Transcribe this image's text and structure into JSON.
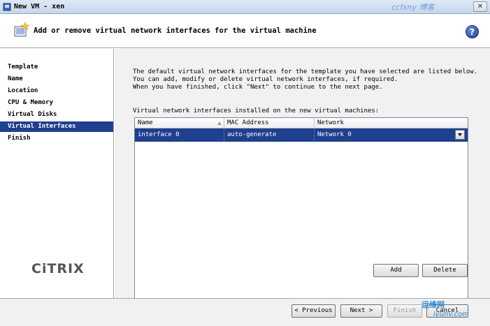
{
  "window": {
    "title": "New VM - xen",
    "close_label": "✕"
  },
  "watermarks": {
    "top": "ccfxny 博客",
    "bottom_cn": "运维网",
    "bottom_url": "iyunv.com"
  },
  "header": {
    "title": "Add or remove virtual network interfaces for the virtual machine",
    "help_label": "?"
  },
  "sidebar": {
    "items": [
      {
        "label": "Template"
      },
      {
        "label": "Name"
      },
      {
        "label": "Location"
      },
      {
        "label": "CPU & Memory"
      },
      {
        "label": "Virtual Disks"
      },
      {
        "label": "Virtual Interfaces"
      },
      {
        "label": "Finish"
      }
    ],
    "active_index": 5,
    "logo_text": "CiTRIX"
  },
  "main": {
    "intro_lines": [
      "The default virtual network interfaces for the template you have selected are listed below.",
      "You can add, modify or delete virtual network interfaces, if required.",
      "When you have finished, click \"Next\" to continue to the next page."
    ],
    "table_label": "Virtual network interfaces installed on the new virtual machines:",
    "table": {
      "columns": [
        "Name",
        "MAC Address",
        "Network"
      ],
      "rows": [
        {
          "name": "interface 0",
          "mac": "auto-generate",
          "network": "Network 0"
        }
      ]
    },
    "add_label": "Add",
    "delete_label": "Delete"
  },
  "footer": {
    "previous_label": "< Previous",
    "next_label": "Next >",
    "finish_label": "Finish",
    "cancel_label": "Cancel"
  },
  "colors": {
    "selection": "#1f3f8f",
    "panel": "#f1f1f1"
  }
}
